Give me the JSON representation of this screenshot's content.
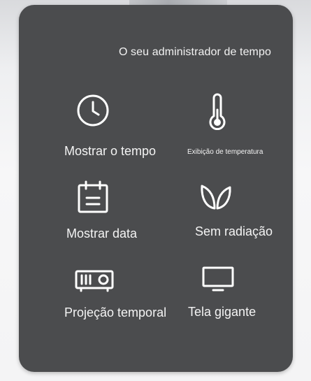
{
  "subtitle": "O seu administrador de tempo",
  "features": [
    {
      "icon": "clock-icon",
      "label": "Mostrar o tempo"
    },
    {
      "icon": "thermometer-icon",
      "label": "Exibição de temperatura"
    },
    {
      "icon": "calendar-icon",
      "label": "Mostrar data"
    },
    {
      "icon": "leaf-icon",
      "label": "Sem radiação"
    },
    {
      "icon": "projector-icon",
      "label": "Projeção temporal"
    },
    {
      "icon": "monitor-icon",
      "label": "Tela gigante"
    }
  ],
  "colors": {
    "card": "#4b4c4e",
    "text": "#f4f4f4"
  }
}
